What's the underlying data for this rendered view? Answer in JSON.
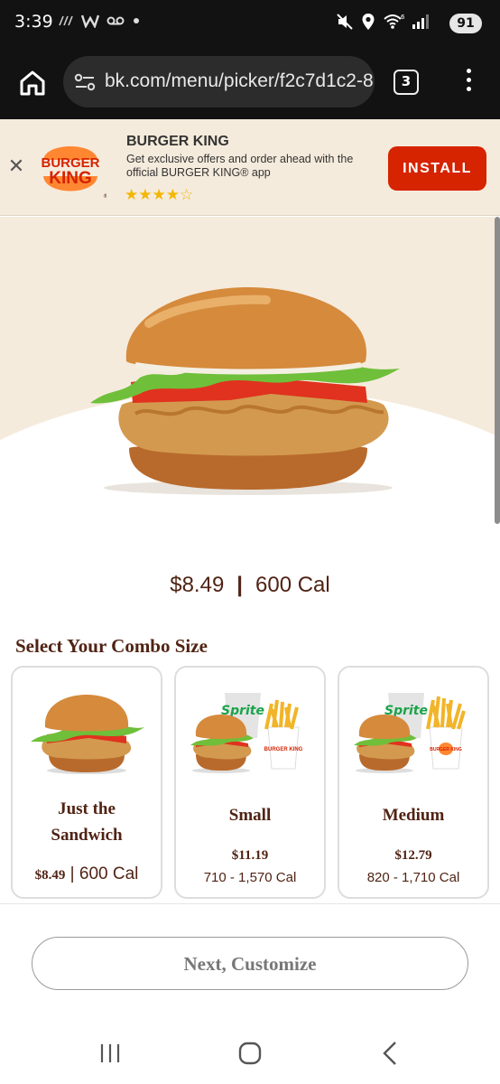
{
  "status_bar": {
    "time": "3:39",
    "left_icons": [
      "wifi-calling-icon",
      "wwe-icon",
      "voicemail-icon",
      "dot-icon"
    ],
    "right_icons": [
      "mute-vibrate-icon",
      "location-icon",
      "wifi-6-icon",
      "signal-icon"
    ],
    "battery": "91"
  },
  "browser": {
    "url": "bk.com/menu/picker/f2c7d1c2-8",
    "tab_count": "3"
  },
  "app_banner": {
    "title": "BURGER KING",
    "description": "Get exclusive offers and order ahead with the official BURGER KING® app",
    "logo_text": "BURGER KING",
    "rating": 4.5,
    "stars": "★★★★☆",
    "install_label": "INSTALL"
  },
  "product": {
    "price": "$8.49",
    "separator": "|",
    "calories": "600 Cal"
  },
  "combo_section": {
    "title": "Select Your Combo Size",
    "options": [
      {
        "name_line1": "Just the",
        "name_line2": "Sandwich",
        "price": "$8.49",
        "separator": "|",
        "calories": "600 Cal"
      },
      {
        "name": "Small",
        "price": "$11.19",
        "calories": "710 - 1,570 Cal",
        "drink_label": "Sprite",
        "cup_label": "BURGER KING"
      },
      {
        "name": "Medium",
        "price": "$12.79",
        "calories": "820 - 1,710 Cal",
        "drink_label": "Sprite",
        "cup_label": "BURGER KING"
      }
    ]
  },
  "next_button": "Next, Customize",
  "colors": {
    "brand_red": "#d62300",
    "brand_brown": "#502314",
    "cream": "#f5ebdc",
    "logo_orange": "#ff8732"
  }
}
